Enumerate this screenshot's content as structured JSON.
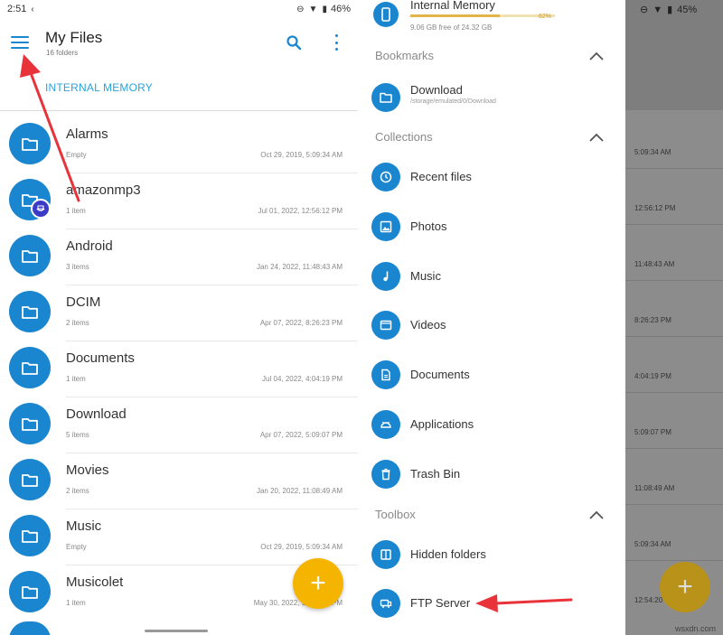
{
  "left": {
    "status": {
      "time": "2:51",
      "battery": "46%"
    },
    "title": "My Files",
    "subtitle": "16 folders",
    "breadcrumb": "INTERNAL MEMORY",
    "files": [
      {
        "name": "Alarms",
        "meta": "Empty",
        "date": "Oct 29, 2019, 5:09:34 AM"
      },
      {
        "name": "amazonmp3",
        "meta": "1 item",
        "date": "Jul 01, 2022, 12:56:12 PM"
      },
      {
        "name": "Android",
        "meta": "3 items",
        "date": "Jan 24, 2022, 11:48:43 AM"
      },
      {
        "name": "DCIM",
        "meta": "2 items",
        "date": "Apr 07, 2022, 8:26:23 PM"
      },
      {
        "name": "Documents",
        "meta": "1 item",
        "date": "Jul 04, 2022, 4:04:19 PM"
      },
      {
        "name": "Download",
        "meta": "5 items",
        "date": "Apr 07, 2022, 5:09:07 PM"
      },
      {
        "name": "Movies",
        "meta": "2 items",
        "date": "Jan 20, 2022, 11:08:49 AM"
      },
      {
        "name": "Music",
        "meta": "Empty",
        "date": "Oct 29, 2019, 5:09:34 AM"
      },
      {
        "name": "Musicolet",
        "meta": "1 item",
        "date": "May 30, 2022, 12:54:20 PM"
      }
    ],
    "fab": "+"
  },
  "right": {
    "status": {
      "battery": "45%"
    },
    "storage": {
      "name": "Internal Memory",
      "percent": "62%",
      "fill": 0.62,
      "free": "9.06 GB free of 24.32 GB"
    },
    "bookmarks": {
      "header": "Bookmarks",
      "items": [
        {
          "label": "Download",
          "path": "/storage/emulated/0/Download",
          "icon": "folder-icon"
        }
      ]
    },
    "collections": {
      "header": "Collections",
      "items": [
        {
          "label": "Recent files",
          "icon": "clock-icon"
        },
        {
          "label": "Photos",
          "icon": "image-icon"
        },
        {
          "label": "Music",
          "icon": "music-note-icon"
        },
        {
          "label": "Videos",
          "icon": "video-icon"
        },
        {
          "label": "Documents",
          "icon": "document-icon"
        },
        {
          "label": "Applications",
          "icon": "android-icon"
        },
        {
          "label": "Trash Bin",
          "icon": "trash-icon"
        }
      ]
    },
    "toolbox": {
      "header": "Toolbox",
      "items": [
        {
          "label": "Hidden folders",
          "icon": "hidden-folder-icon"
        },
        {
          "label": "FTP Server",
          "icon": "ftp-server-icon"
        }
      ]
    },
    "ghost_dates": [
      "5:09:34 AM",
      "12:56:12 PM",
      "11:48:43 AM",
      "8:26:23 PM",
      "4:04:19 PM",
      "5:09:07 PM",
      "11:08:49 AM",
      "5:09:34 AM",
      "12:54:20 PM"
    ],
    "fab": "+"
  },
  "watermark": "wsxdn.com",
  "colors": {
    "accent": "#1a86d0",
    "fab": "#f4b400",
    "annotation_arrow": "#e8333a",
    "breadcrumb": "#2aa3d9"
  }
}
